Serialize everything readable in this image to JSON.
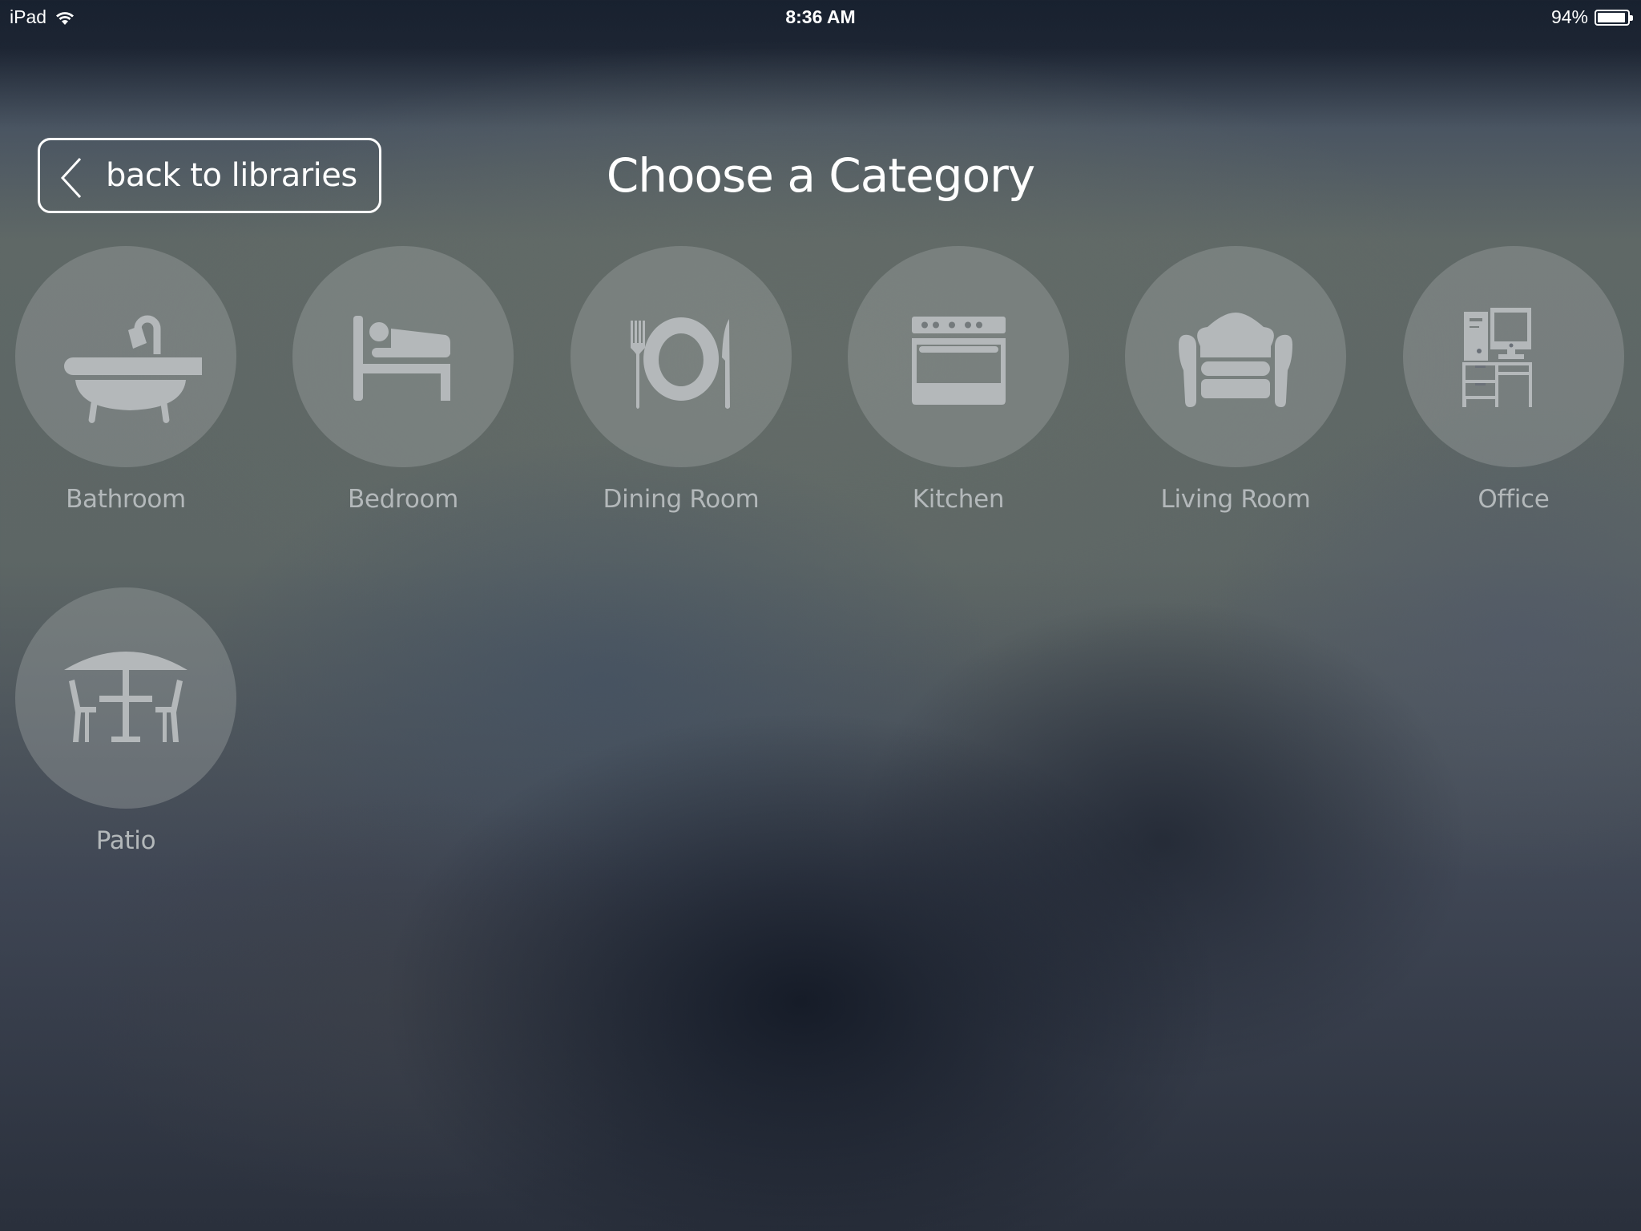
{
  "status_bar": {
    "device": "iPad",
    "time": "8:36 AM",
    "battery_percent_label": "94%",
    "battery_level": 0.94,
    "wifi_icon": "wifi-icon",
    "battery_icon": "battery-icon"
  },
  "header": {
    "back_button_label": "back to libraries",
    "back_icon": "chevron-left-icon",
    "title": "Choose a Category"
  },
  "categories": [
    {
      "label": "Bathroom",
      "icon": "bathtub-icon"
    },
    {
      "label": "Bedroom",
      "icon": "bed-icon"
    },
    {
      "label": "Dining Room",
      "icon": "plate-cutlery-icon"
    },
    {
      "label": "Kitchen",
      "icon": "oven-icon"
    },
    {
      "label": "Living Room",
      "icon": "armchair-icon"
    },
    {
      "label": "Office",
      "icon": "computer-desk-icon"
    },
    {
      "label": "Patio",
      "icon": "patio-table-icon"
    }
  ],
  "colors": {
    "text_primary": "#ffffff",
    "category_label": "#b3b8ba",
    "icon_fill": "#b4b8ba"
  }
}
